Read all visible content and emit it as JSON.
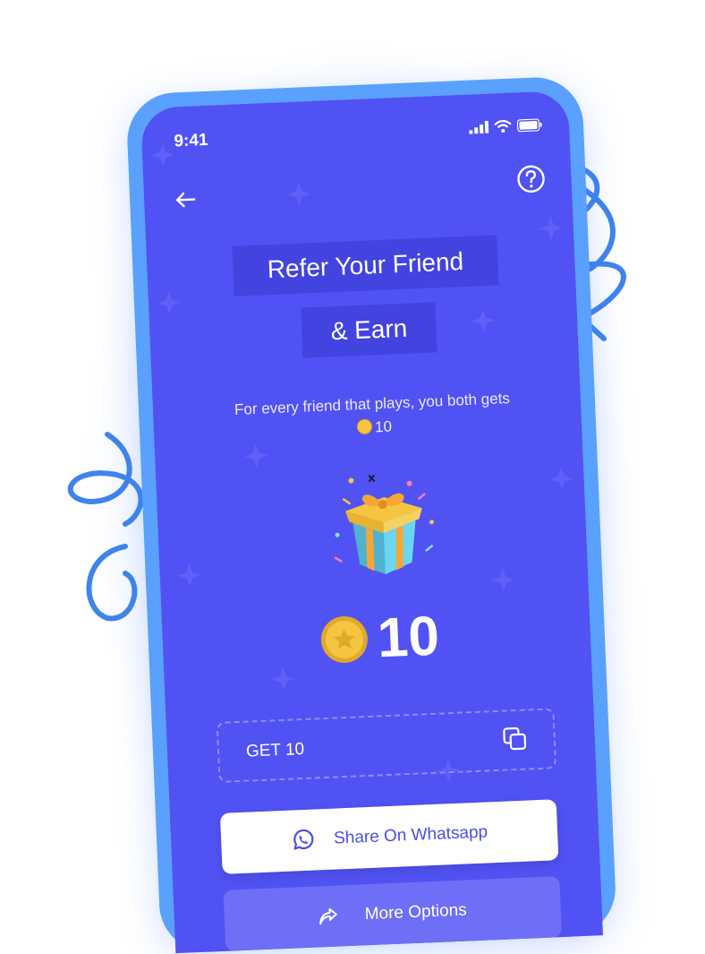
{
  "status_bar": {
    "time": "9:41"
  },
  "header": {
    "back_icon": "arrow-left-icon",
    "help_icon": "question-circle-icon"
  },
  "hero": {
    "title_line1": "Refer Your Friend",
    "title_line2": "& Earn",
    "subtitle_part1": "For every friend that plays, you both gets",
    "subtitle_reward": "10"
  },
  "reward": {
    "amount": "10",
    "icon": "coin-icon"
  },
  "referral_code": {
    "code": "GET 10",
    "copy_icon": "copy-icon"
  },
  "actions": {
    "share_label": "Share On Whatsapp",
    "share_icon": "whatsapp-icon",
    "more_label": "More Options",
    "more_icon": "share-icon"
  },
  "colors": {
    "screen_bg": "#5152f3",
    "frame": "#5aa0ff",
    "title_box": "#4343e0",
    "button_text": "#4b4ee6",
    "coin": "#f5c542"
  }
}
